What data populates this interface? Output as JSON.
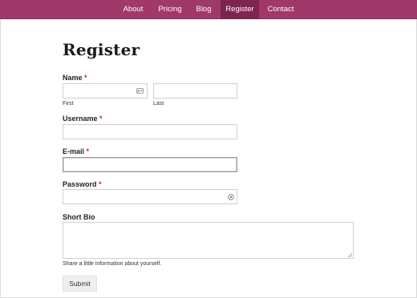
{
  "nav": {
    "items": [
      {
        "label": "About",
        "active": false
      },
      {
        "label": "Pricing",
        "active": false
      },
      {
        "label": "Blog",
        "active": false
      },
      {
        "label": "Register",
        "active": true
      },
      {
        "label": "Contact",
        "active": false
      }
    ]
  },
  "form": {
    "title": "Register",
    "required_mark": "*",
    "name": {
      "label": "Name",
      "first_sublabel": "First",
      "last_sublabel": "Last",
      "first_value": "",
      "last_value": ""
    },
    "username": {
      "label": "Username",
      "value": ""
    },
    "email": {
      "label": "E-mail",
      "value": ""
    },
    "password": {
      "label": "Password",
      "value": ""
    },
    "bio": {
      "label": "Short Bio",
      "value": "",
      "helper": "Share a little information about yourself."
    },
    "submit_label": "Submit"
  },
  "colors": {
    "nav_bg": "#a0386a",
    "nav_active_bg": "#7d2450",
    "required": "#c0292b"
  },
  "icons": [
    "contact-card-icon",
    "password-reveal-icon",
    "resize-handle-icon"
  ]
}
